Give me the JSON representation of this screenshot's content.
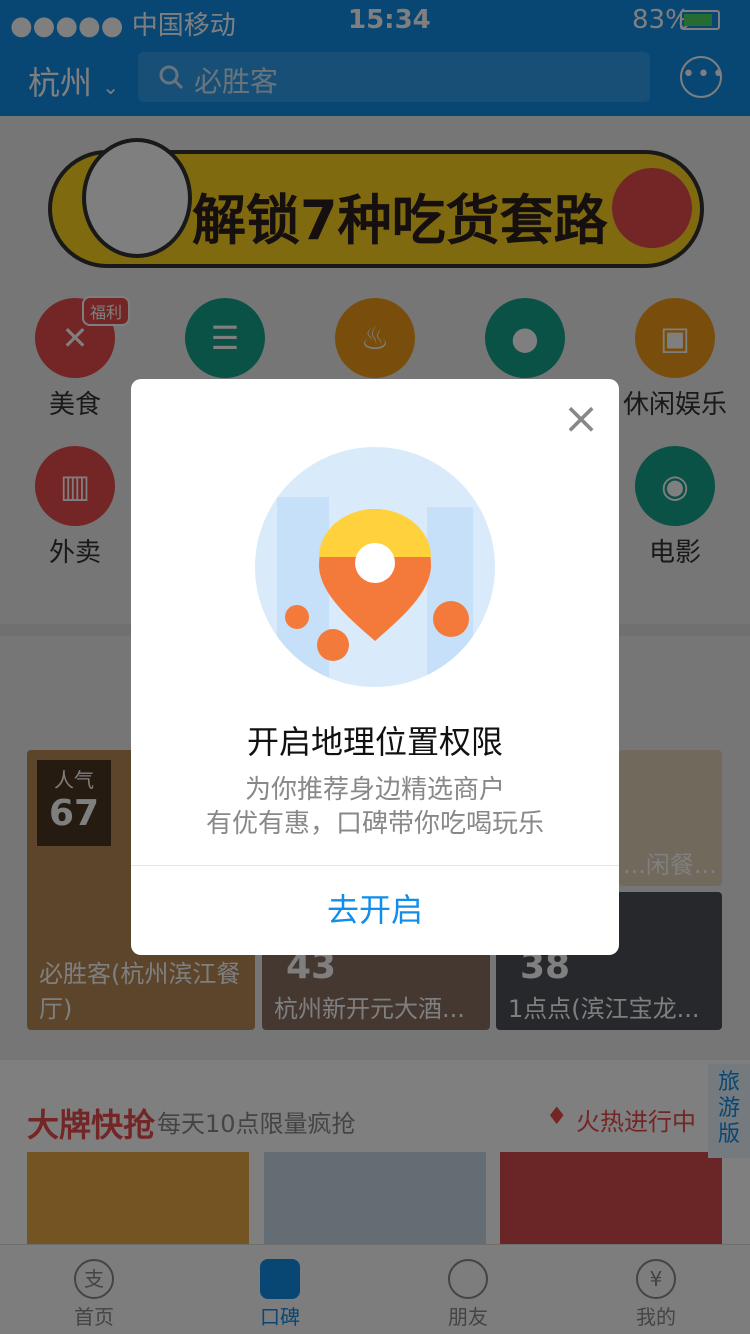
{
  "status": {
    "carrier": "●●●●● 中国移动",
    "time": "15:34",
    "battery": "83%"
  },
  "header": {
    "city": "杭州",
    "search_placeholder": "必胜客"
  },
  "banner": {
    "text": "解锁7种吃货套路"
  },
  "categories": [
    {
      "label": "美食",
      "badge": "福利",
      "color": "#e84a4a"
    },
    {
      "label": "",
      "color": "#15a38c"
    },
    {
      "label": "",
      "color": "#f29c18"
    },
    {
      "label": "",
      "color": "#15a38c"
    },
    {
      "label": "休闲娱乐",
      "color": "#f29c18"
    },
    {
      "label": "外卖",
      "color": "#e84a4a"
    },
    {
      "label": "电影",
      "color": "#15a38c"
    }
  ],
  "cards": [
    {
      "badge_top": "人气",
      "badge_num": "67",
      "name": "必胜客(杭州滨江餐厅)"
    },
    {
      "badge_num": "43",
      "name": "杭州新开元大酒..."
    },
    {
      "badge_num": "38",
      "name": "1点点(滨江宝龙..."
    },
    {
      "name": "...闲餐..."
    }
  ],
  "brand": {
    "title": "大牌快抢",
    "subtitle": "每天10点限量疯抢",
    "hot": "火热进行中"
  },
  "side_tab": {
    "label": "旅游版"
  },
  "tabbar": [
    {
      "label": "首页",
      "icon": "支"
    },
    {
      "label": "口碑",
      "icon": ""
    },
    {
      "label": "朋友",
      "icon": ""
    },
    {
      "label": "我的",
      "icon": "¥"
    }
  ],
  "dialog": {
    "title": "开启地理位置权限",
    "desc_line1": "为你推荐身边精选商户",
    "desc_line2": "有优有惠，口碑带你吃喝玩乐",
    "action": "去开启"
  },
  "colors": {
    "primary": "#108ee9",
    "brand_red": "#e84a4a",
    "banner_yellow": "#ffd41e"
  }
}
